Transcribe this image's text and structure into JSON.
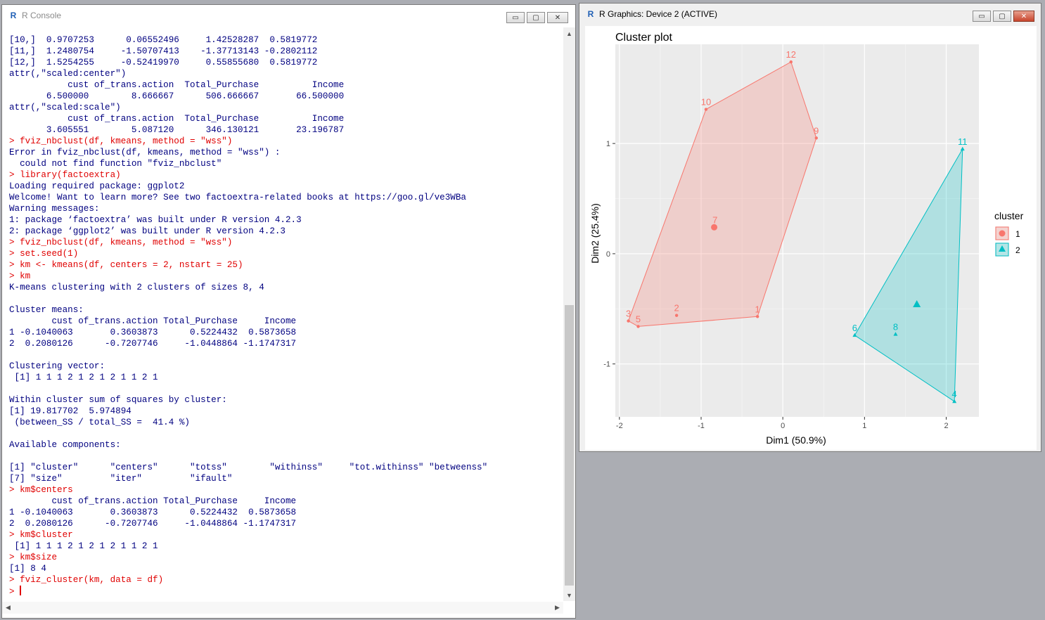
{
  "console": {
    "title": "R Console",
    "lines": [
      {
        "t": "out",
        "s": "[10,]  0.9707253      0.06552496     1.42528287  0.5819772"
      },
      {
        "t": "out",
        "s": "[11,]  1.2480754     -1.50707413    -1.37713143 -0.2802112"
      },
      {
        "t": "out",
        "s": "[12,]  1.5254255     -0.52419970     0.55855680  0.5819772"
      },
      {
        "t": "out",
        "s": "attr(,\"scaled:center\")"
      },
      {
        "t": "out",
        "s": "           cust of_trans.action  Total_Purchase          Income"
      },
      {
        "t": "out",
        "s": "       6.500000        8.666667      506.666667       66.500000"
      },
      {
        "t": "out",
        "s": "attr(,\"scaled:scale\")"
      },
      {
        "t": "out",
        "s": "           cust of_trans.action  Total_Purchase          Income"
      },
      {
        "t": "out",
        "s": "       3.605551        5.087120      346.130121       23.196787"
      },
      {
        "t": "in",
        "s": "> fviz_nbclust(df, kmeans, method = \"wss\")"
      },
      {
        "t": "out",
        "s": "Error in fviz_nbclust(df, kmeans, method = \"wss\") :"
      },
      {
        "t": "out",
        "s": "  could not find function \"fviz_nbclust\""
      },
      {
        "t": "in",
        "s": "> library(factoextra)"
      },
      {
        "t": "out",
        "s": "Loading required package: ggplot2"
      },
      {
        "t": "out",
        "s": "Welcome! Want to learn more? See two factoextra-related books at https://goo.gl/ve3WBa"
      },
      {
        "t": "out",
        "s": "Warning messages:"
      },
      {
        "t": "out",
        "s": "1: package ‘factoextra’ was built under R version 4.2.3"
      },
      {
        "t": "out",
        "s": "2: package ‘ggplot2’ was built under R version 4.2.3"
      },
      {
        "t": "in",
        "s": "> fviz_nbclust(df, kmeans, method = \"wss\")"
      },
      {
        "t": "in",
        "s": "> set.seed(1)"
      },
      {
        "t": "in",
        "s": "> km <- kmeans(df, centers = 2, nstart = 25)"
      },
      {
        "t": "in",
        "s": "> km"
      },
      {
        "t": "out",
        "s": "K-means clustering with 2 clusters of sizes 8, 4"
      },
      {
        "t": "out",
        "s": ""
      },
      {
        "t": "out",
        "s": "Cluster means:"
      },
      {
        "t": "out",
        "s": "        cust of_trans.action Total_Purchase     Income"
      },
      {
        "t": "out",
        "s": "1 -0.1040063       0.3603873      0.5224432  0.5873658"
      },
      {
        "t": "out",
        "s": "2  0.2080126      -0.7207746     -1.0448864 -1.1747317"
      },
      {
        "t": "out",
        "s": ""
      },
      {
        "t": "out",
        "s": "Clustering vector:"
      },
      {
        "t": "out",
        "s": " [1] 1 1 1 2 1 2 1 2 1 1 2 1"
      },
      {
        "t": "out",
        "s": ""
      },
      {
        "t": "out",
        "s": "Within cluster sum of squares by cluster:"
      },
      {
        "t": "out",
        "s": "[1] 19.817702  5.974894"
      },
      {
        "t": "out",
        "s": " (between_SS / total_SS =  41.4 %)"
      },
      {
        "t": "out",
        "s": ""
      },
      {
        "t": "out",
        "s": "Available components:"
      },
      {
        "t": "out",
        "s": ""
      },
      {
        "t": "out",
        "s": "[1] \"cluster\"      \"centers\"      \"totss\"        \"withinss\"     \"tot.withinss\" \"betweenss\""
      },
      {
        "t": "out",
        "s": "[7] \"size\"         \"iter\"         \"ifault\""
      },
      {
        "t": "in",
        "s": "> km$centers"
      },
      {
        "t": "out",
        "s": "        cust of_trans.action Total_Purchase     Income"
      },
      {
        "t": "out",
        "s": "1 -0.1040063       0.3603873      0.5224432  0.5873658"
      },
      {
        "t": "out",
        "s": "2  0.2080126      -0.7207746     -1.0448864 -1.1747317"
      },
      {
        "t": "in",
        "s": "> km$cluster"
      },
      {
        "t": "out",
        "s": " [1] 1 1 1 2 1 2 1 2 1 1 2 1"
      },
      {
        "t": "in",
        "s": "> km$size"
      },
      {
        "t": "out",
        "s": "[1] 8 4"
      },
      {
        "t": "in",
        "s": "> fviz_cluster(km, data = df)"
      }
    ],
    "prompt": ">"
  },
  "graphics": {
    "title": "R Graphics: Device 2 (ACTIVE)"
  },
  "window_controls": {
    "minimize": "▭",
    "maximize": "▢",
    "close": "✕"
  },
  "chart_data": {
    "type": "scatter",
    "title": "Cluster plot",
    "xlabel": "Dim1 (50.9%)",
    "ylabel": "Dim2 (25.4%)",
    "xlim": [
      -2.05,
      2.4
    ],
    "ylim": [
      -1.48,
      1.9
    ],
    "xticks": [
      -2,
      -1,
      0,
      1,
      2
    ],
    "yticks": [
      -1,
      0,
      1
    ],
    "grid": true,
    "legend": {
      "title": "cluster",
      "position": "right",
      "entries": [
        "1",
        "2"
      ]
    },
    "colors": {
      "1": "#f8766d",
      "2": "#00bfc4"
    },
    "panel_bg": "#ebebeb",
    "series": [
      {
        "name": "1",
        "points": [
          {
            "label": "1",
            "x": -0.31,
            "y": -0.57
          },
          {
            "label": "2",
            "x": -1.3,
            "y": -0.56
          },
          {
            "label": "3",
            "x": -1.89,
            "y": -0.61
          },
          {
            "label": "5",
            "x": -1.77,
            "y": -0.66
          },
          {
            "label": "7",
            "x": -0.83,
            "y": 0.24
          },
          {
            "label": "9",
            "x": 0.41,
            "y": 1.05
          },
          {
            "label": "10",
            "x": -0.94,
            "y": 1.31
          },
          {
            "label": "12",
            "x": 0.1,
            "y": 1.74
          }
        ],
        "center": {
          "x": -0.84,
          "y": 0.24
        }
      },
      {
        "name": "2",
        "points": [
          {
            "label": "4",
            "x": 2.1,
            "y": -1.34
          },
          {
            "label": "6",
            "x": 0.88,
            "y": -0.74
          },
          {
            "label": "8",
            "x": 1.38,
            "y": -0.73
          },
          {
            "label": "11",
            "x": 2.2,
            "y": 0.95
          }
        ],
        "center": {
          "x": 1.64,
          "y": -0.46
        }
      }
    ]
  }
}
